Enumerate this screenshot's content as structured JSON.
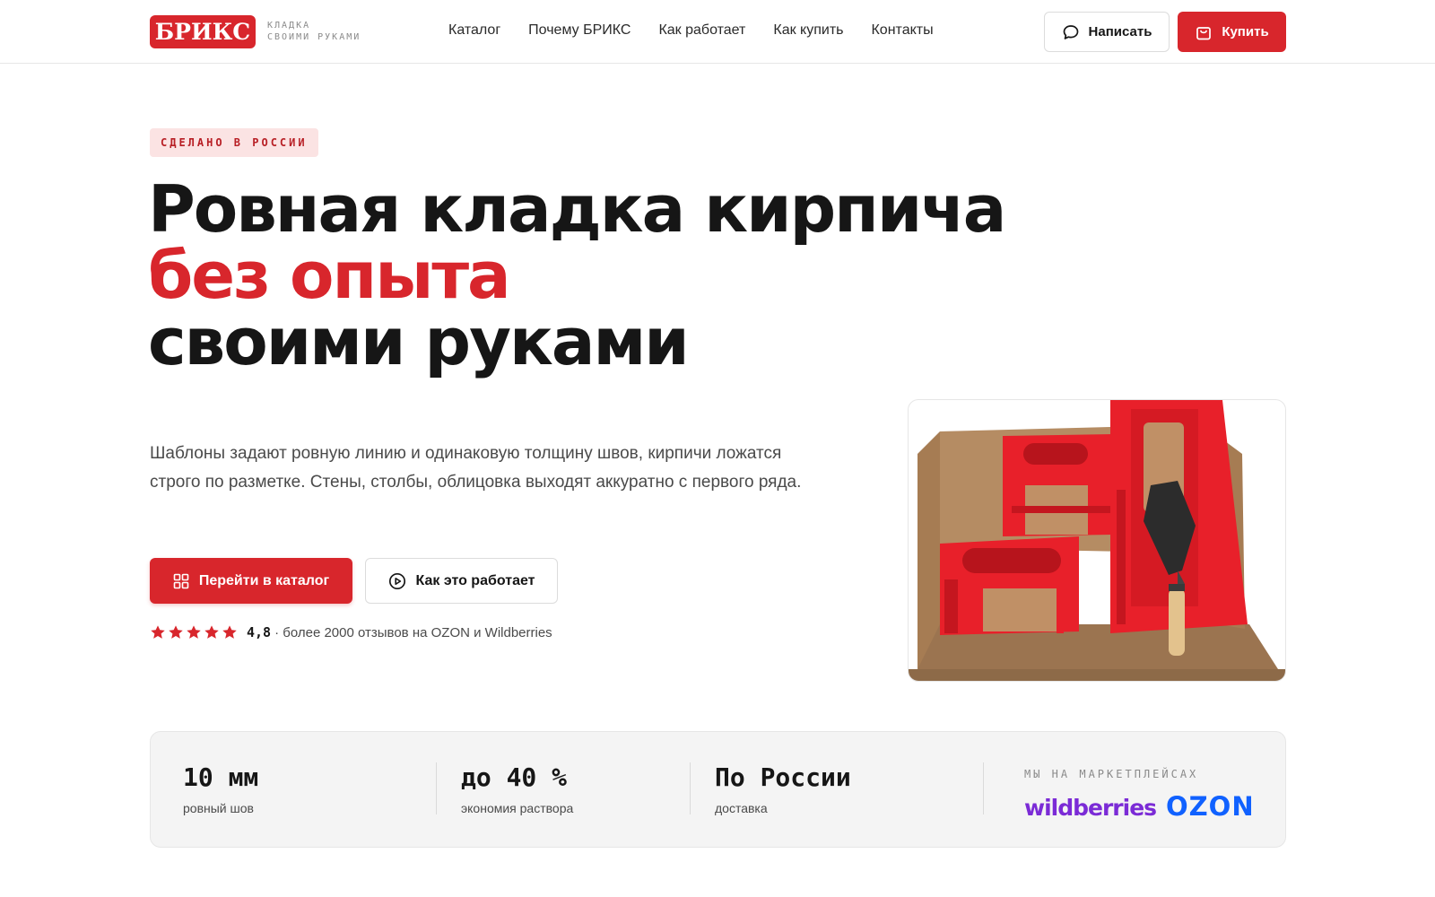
{
  "header": {
    "logo_text": "БРИКС",
    "tagline_line1": "КЛАДКА",
    "tagline_line2": "СВОИМИ РУКАМИ",
    "nav": [
      "Каталог",
      "Почему БРИКС",
      "Как работает",
      "Как купить",
      "Контакты"
    ],
    "write_label": "Написать",
    "buy_label": "Купить"
  },
  "hero": {
    "badge": "СДЕЛАНО В РОССИИ",
    "title_line1": "Ровная кладка кирпича",
    "title_line2": "без опыта",
    "title_line3": "своими руками",
    "description": "Шаблоны задают ровную линию и одинаковую толщину швов, кирпичи ложатся строго по разметке. Стены, столбы, облицовка выходят аккуратно с первого ряда.",
    "catalog_button": "Перейти в каталог",
    "how_button": "Как это работает",
    "rating_stars": 5,
    "rating_value": "4,8",
    "rating_text": "· более 2000 отзывов на OZON и Wildberries"
  },
  "stats": {
    "items": [
      {
        "value": "10 мм",
        "label": "ровный шов"
      },
      {
        "value": "до 40 %",
        "label": "экономия раствора"
      },
      {
        "value": "По России",
        "label": "доставка"
      }
    ],
    "marketplaces_title": "МЫ НА МАРКЕТПЛЕЙСАХ",
    "wildberries": "wildberries",
    "ozon": "OZON"
  },
  "colors": {
    "accent": "#d8262c",
    "badge_bg": "#fbe3e3",
    "wildberries": "#7b2bd6",
    "ozon": "#1061ff"
  },
  "icons": [
    "chat-bubble-icon",
    "shopping-bag-icon",
    "grid-icon",
    "play-circle-icon",
    "star-icon"
  ]
}
